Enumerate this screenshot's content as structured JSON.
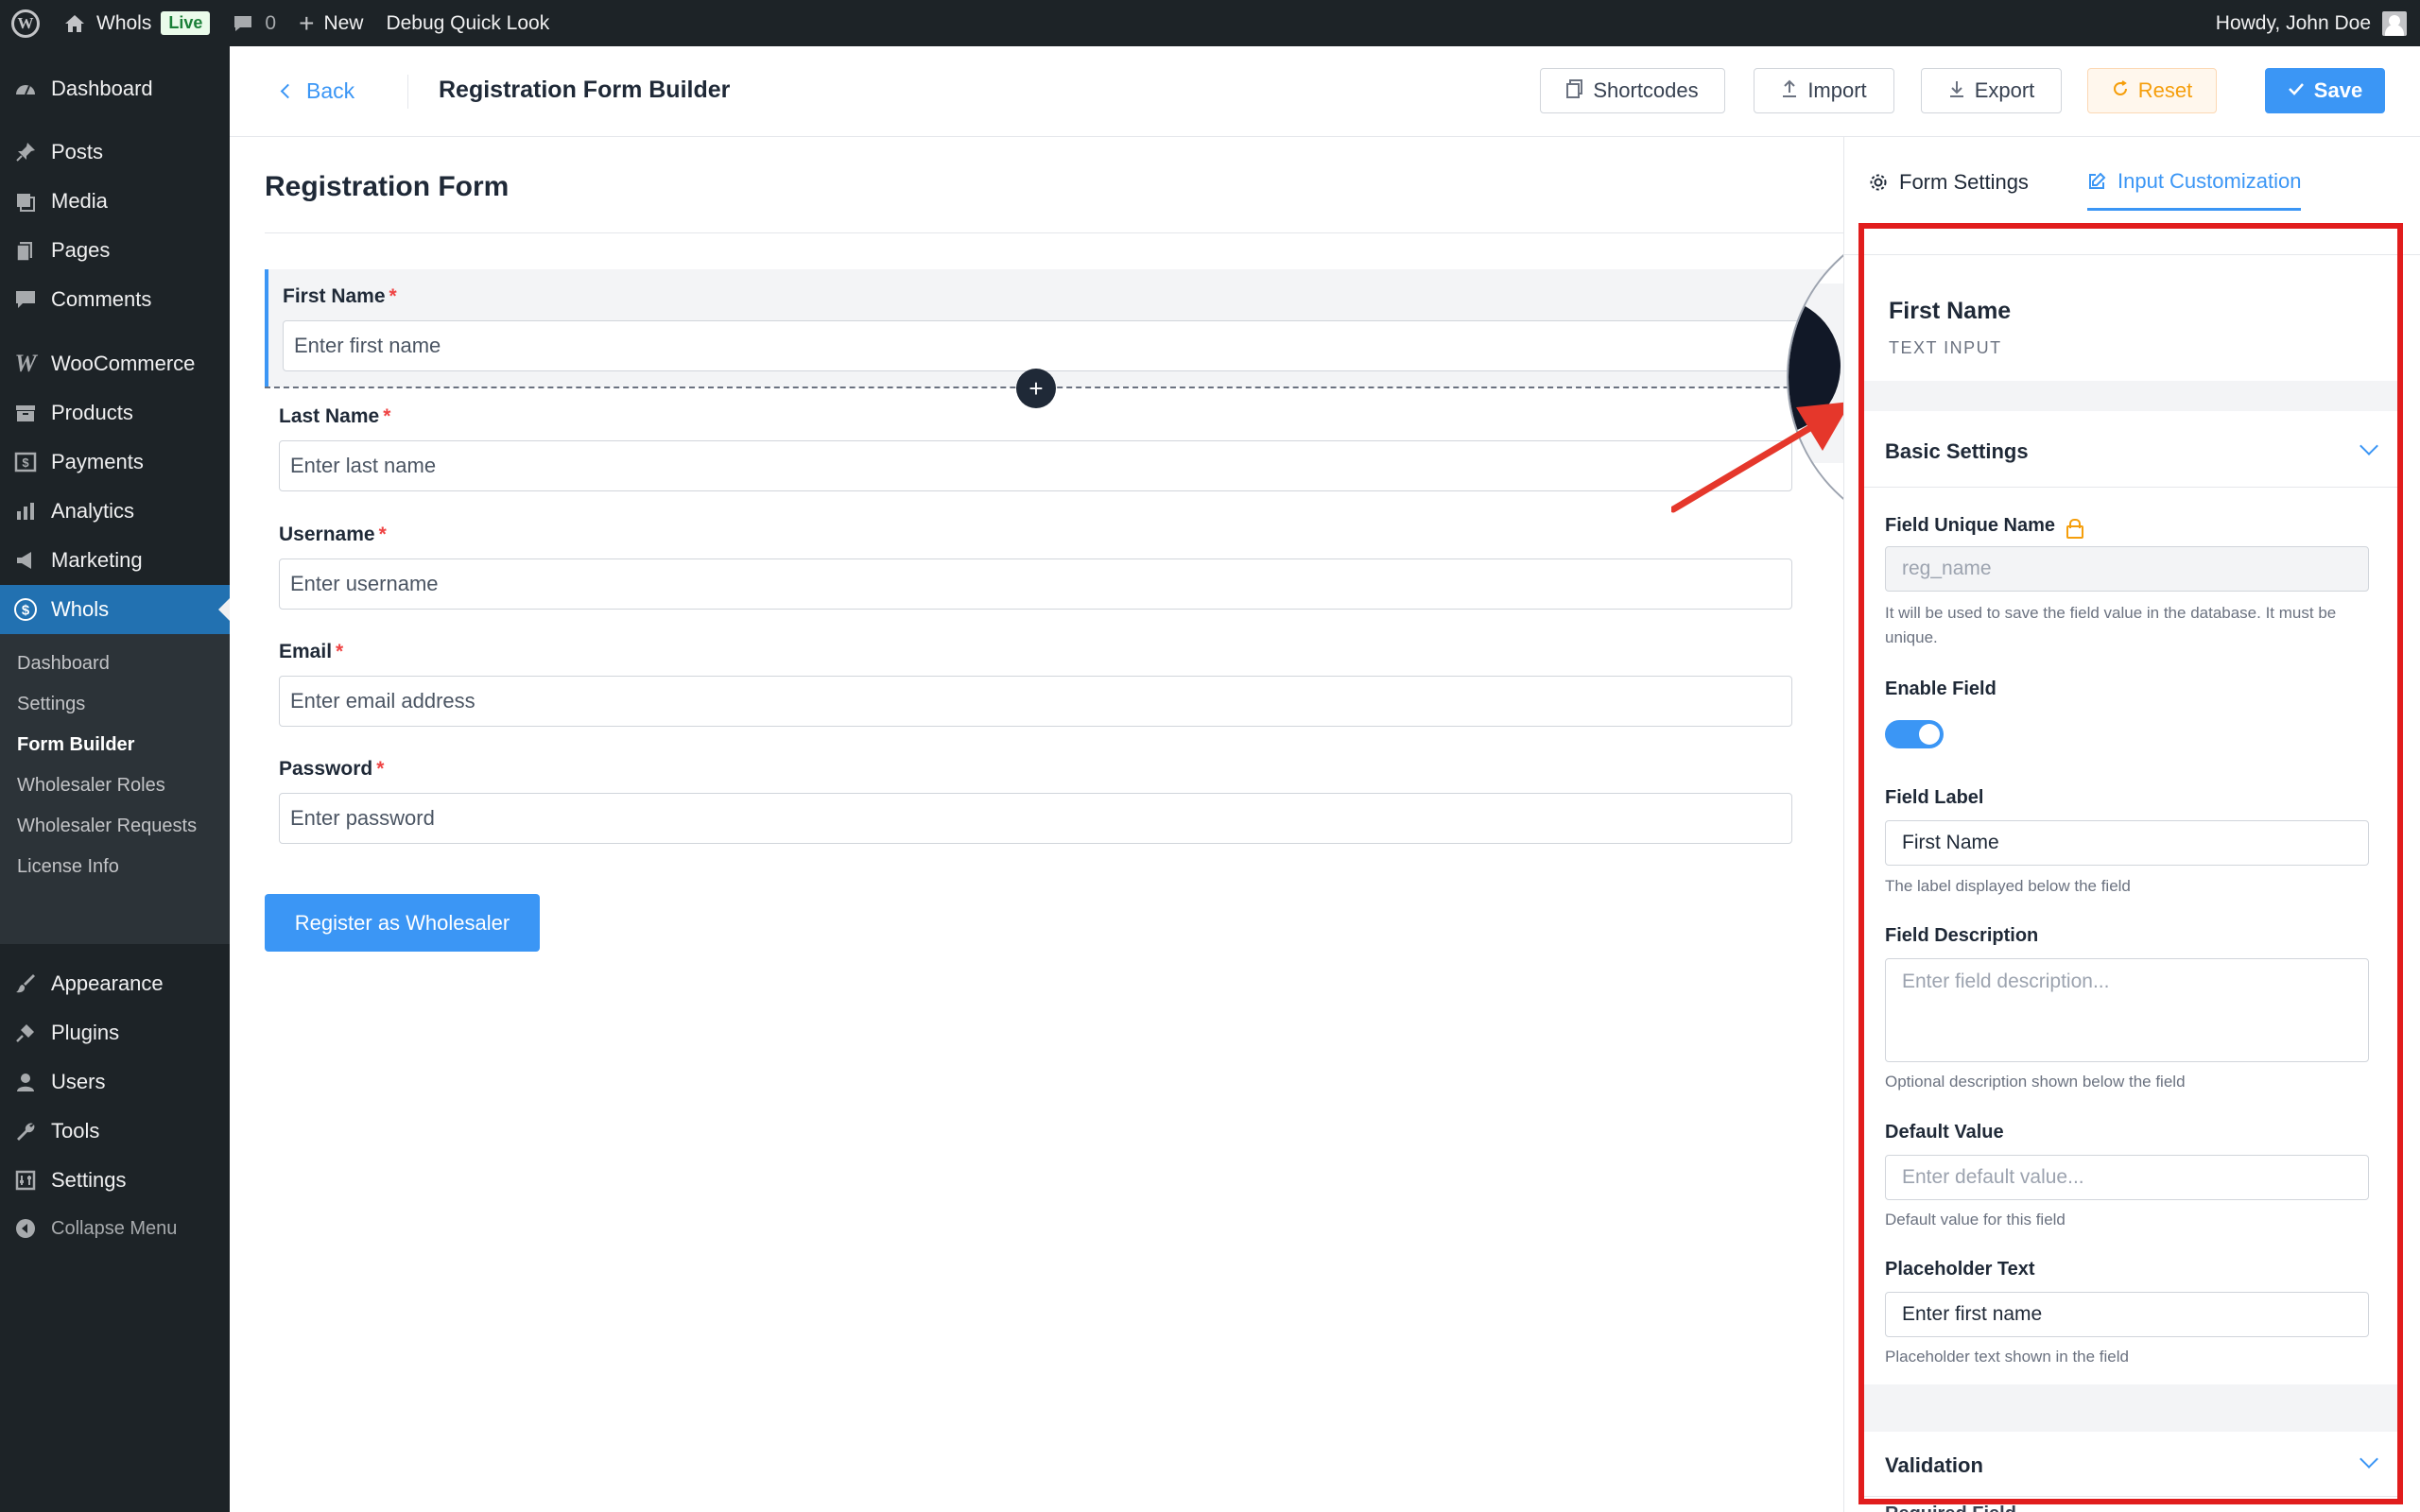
{
  "admin_bar": {
    "site_name": "Whols",
    "live_badge": "Live",
    "comments_count": "0",
    "new_label": "New",
    "debug_label": "Debug Quick Look",
    "greeting": "Howdy, John Doe"
  },
  "sidebar": {
    "items": [
      {
        "label": "Dashboard",
        "icon": "dashboard-icon"
      },
      {
        "label": "Posts",
        "icon": "pin-icon"
      },
      {
        "label": "Media",
        "icon": "media-icon"
      },
      {
        "label": "Pages",
        "icon": "pages-icon"
      },
      {
        "label": "Comments",
        "icon": "comment-icon"
      },
      {
        "label": "WooCommerce",
        "icon": "woocommerce-icon"
      },
      {
        "label": "Products",
        "icon": "products-icon"
      },
      {
        "label": "Payments",
        "icon": "payments-icon"
      },
      {
        "label": "Analytics",
        "icon": "analytics-icon"
      },
      {
        "label": "Marketing",
        "icon": "marketing-icon"
      },
      {
        "label": "Whols",
        "icon": "dollar-icon"
      },
      {
        "label": "Appearance",
        "icon": "brush-icon"
      },
      {
        "label": "Plugins",
        "icon": "plugin-icon"
      },
      {
        "label": "Users",
        "icon": "users-icon"
      },
      {
        "label": "Tools",
        "icon": "wrench-icon"
      },
      {
        "label": "Settings",
        "icon": "settings-icon"
      },
      {
        "label": "Collapse Menu",
        "icon": "collapse-icon"
      }
    ],
    "submenu": [
      "Dashboard",
      "Settings",
      "Form Builder",
      "Wholesaler Roles",
      "Wholesaler Requests",
      "License Info"
    ]
  },
  "topbar": {
    "back_label": "Back",
    "title": "Registration Form Builder",
    "shortcodes_label": "Shortcodes",
    "import_label": "Import",
    "export_label": "Export",
    "reset_label": "Reset",
    "save_label": "Save"
  },
  "form": {
    "heading": "Registration Form",
    "fields": [
      {
        "label": "First Name",
        "placeholder": "Enter first name"
      },
      {
        "label": "Last Name",
        "placeholder": "Enter last name"
      },
      {
        "label": "Username",
        "placeholder": "Enter username"
      },
      {
        "label": "Email",
        "placeholder": "Enter email address"
      },
      {
        "label": "Password",
        "placeholder": "Enter password"
      }
    ],
    "submit_label": "Register as Wholesaler"
  },
  "panel": {
    "tabs": [
      "Form Settings",
      "Input Customization"
    ],
    "field_title": "First Name",
    "field_type": "TEXT INPUT",
    "basic_settings": {
      "title": "Basic Settings",
      "unique_name_label": "Field Unique Name",
      "unique_name_value": "reg_name",
      "unique_name_help": "It will be used to save the field value in the database. It must be unique.",
      "enable_label": "Enable Field",
      "field_label_label": "Field Label",
      "field_label_value": "First Name",
      "field_label_help": "The label displayed below the field",
      "description_label": "Field Description",
      "description_placeholder": "Enter field description...",
      "description_help": "Optional description shown below the field",
      "default_label": "Default Value",
      "default_placeholder": "Enter default value...",
      "default_help": "Default value for this field",
      "placeholder_label": "Placeholder Text",
      "placeholder_value": "Enter first name",
      "placeholder_help": "Placeholder text shown in the field"
    },
    "validation_title": "Validation",
    "next_partial": "Required Field"
  },
  "colors": {
    "accent": "#3b96f5",
    "highlight": "#e11d1d",
    "admin_dark": "#1d2327"
  }
}
